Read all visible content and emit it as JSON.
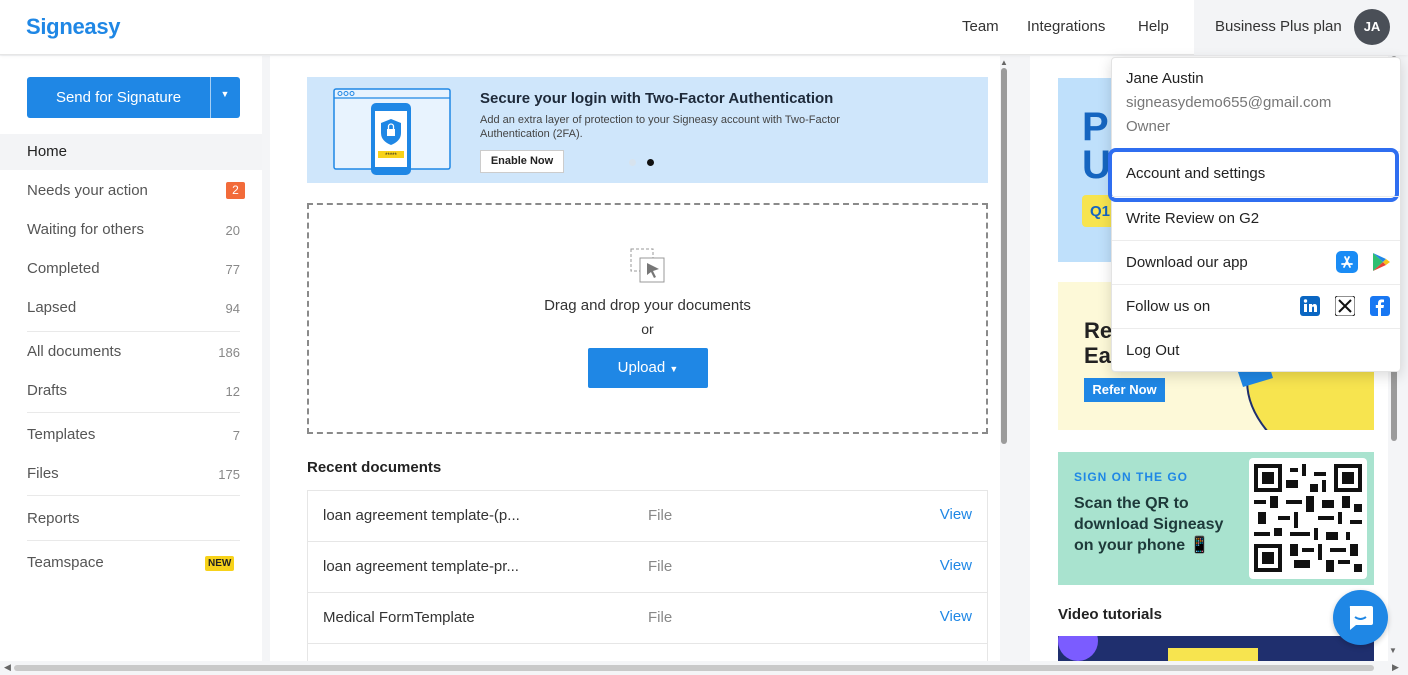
{
  "header": {
    "logo": "Signeasy",
    "nav": [
      "Team",
      "Integrations",
      "Help"
    ],
    "plan": "Business Plus plan",
    "avatar_initials": "JA"
  },
  "sidebar": {
    "send_button": "Send for Signature",
    "items": [
      {
        "label": "Home",
        "count": ""
      },
      {
        "label": "Needs your action",
        "count": "2"
      },
      {
        "label": "Waiting for others",
        "count": "20"
      },
      {
        "label": "Completed",
        "count": "77"
      },
      {
        "label": "Lapsed",
        "count": "94"
      },
      {
        "label": "All documents",
        "count": "186"
      },
      {
        "label": "Drafts",
        "count": "12"
      },
      {
        "label": "Templates",
        "count": "7"
      },
      {
        "label": "Files",
        "count": "175"
      },
      {
        "label": "Reports",
        "count": ""
      },
      {
        "label": "Teamspace",
        "count": "NEW"
      }
    ]
  },
  "banner": {
    "title": "Secure your login with Two-Factor Authentication",
    "description": "Add an extra layer of protection to your Signeasy account with Two-Factor Authentication (2FA).",
    "button": "Enable Now",
    "pin": "*****"
  },
  "dropzone": {
    "text": "Drag and drop your documents",
    "or": "or",
    "upload": "Upload"
  },
  "recent": {
    "title": "Recent documents",
    "rows": [
      {
        "name": "loan agreement template-(p...",
        "type": "File",
        "action": "View"
      },
      {
        "name": "loan agreement template-pr...",
        "type": "File",
        "action": "View"
      },
      {
        "name": "Medical FormTemplate",
        "type": "File",
        "action": "View"
      }
    ]
  },
  "right": {
    "promo1_big": "Pl\nU",
    "promo1_chip": "Q1",
    "promo2_big": "Re\nEa",
    "promo2_button": "Refer Now",
    "qr_eyebrow": "SIGN ON THE GO",
    "qr_text": "Scan the QR to download Signeasy on your phone 📱",
    "video_title": "Video tutorials"
  },
  "dropdown": {
    "name": "Jane Austin",
    "email": "signeasydemo655@gmail.com",
    "role": "Owner",
    "items": [
      "Account and settings",
      "Write Review on G2",
      "Download our app",
      "Follow us on",
      "Log Out"
    ]
  },
  "colors": {
    "accent": "#1f87e5",
    "highlight": "#2f6ef0"
  }
}
